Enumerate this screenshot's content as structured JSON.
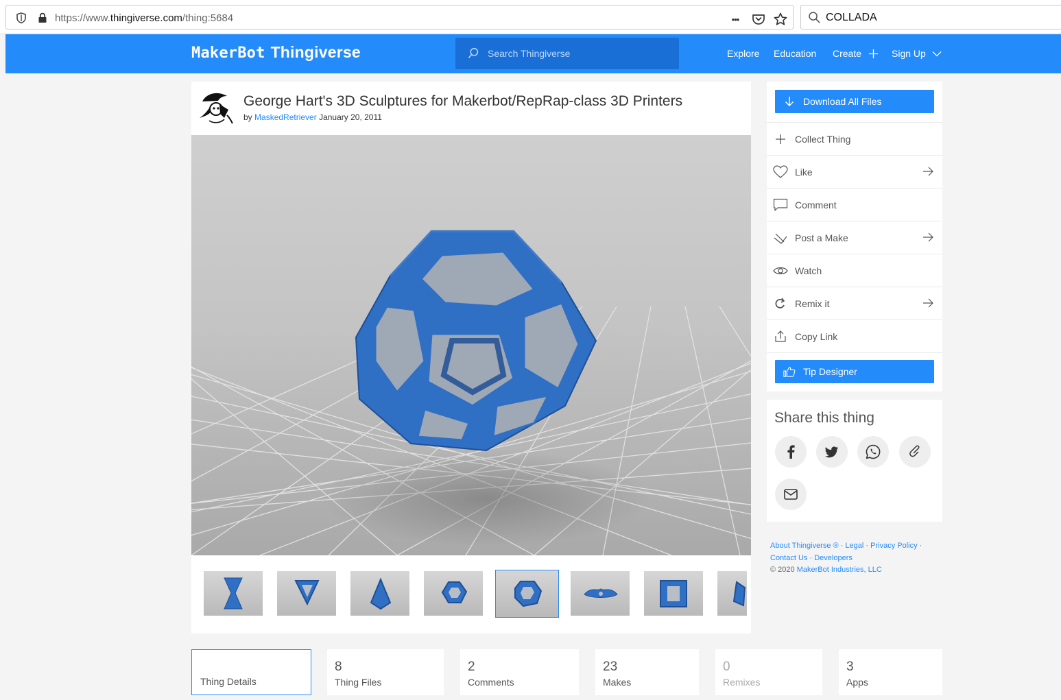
{
  "browser": {
    "url_prefix": "https://www.",
    "url_domain": "thingiverse.com",
    "url_path": "/thing:5684",
    "search_value": "COLLADA",
    "menu_glyph": "•••"
  },
  "header": {
    "logo_makerbot": "MakerBot",
    "logo_thingiverse": "Thingiverse",
    "search_placeholder": "Search Thingiverse",
    "nav": {
      "explore": "Explore",
      "education": "Education",
      "create": "Create",
      "signup": "Sign Up"
    }
  },
  "thing": {
    "title": "George Hart's 3D Sculptures for Makerbot/RepRap-class 3D Printers",
    "by": "by",
    "author": "MaskedRetriever",
    "date": "January 20, 2011",
    "active_thumb": 5,
    "thumb_count_visible": 8
  },
  "actions": {
    "download": "Download All Files",
    "collect": "Collect Thing",
    "like": "Like",
    "comment": "Comment",
    "post_make": "Post a Make",
    "watch": "Watch",
    "remix": "Remix it",
    "copy_link": "Copy Link",
    "tip": "Tip Designer"
  },
  "share": {
    "heading": "Share this thing"
  },
  "footer": {
    "about": "About Thingiverse ®",
    "legal": "Legal",
    "privacy": "Privacy Policy",
    "contact": "Contact Us",
    "developers": "Developers",
    "copyright": "© 2020",
    "company": "MakerBot Industries, LLC",
    "sep": "·"
  },
  "stats": {
    "details": {
      "label": "Thing Details"
    },
    "files": {
      "num": "8",
      "label": "Thing Files"
    },
    "comments": {
      "num": "2",
      "label": "Comments"
    },
    "makes": {
      "num": "23",
      "label": "Makes"
    },
    "remixes": {
      "num": "0",
      "label": "Remixes"
    },
    "apps": {
      "num": "3",
      "label": "Apps"
    }
  },
  "colors": {
    "brand": "#248bfb",
    "model_blue": "#2f6fc4"
  }
}
